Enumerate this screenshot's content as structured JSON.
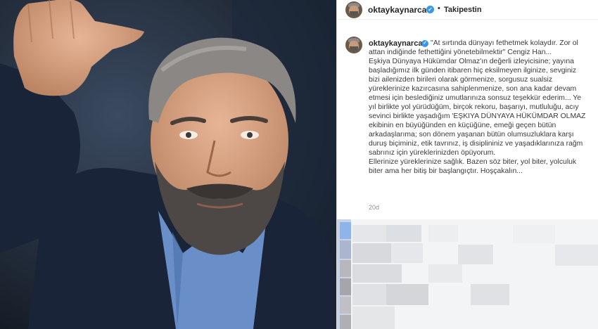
{
  "post": {
    "username": "oktaykaynarca",
    "follow_status": "Takipestin",
    "separator": "•",
    "verified_glyph": "✓",
    "caption_lines": [
      "\"At sırtında dünyayı fethetmek kolaydır. Zor ol",
      "attan indiğinde fethettiğini yönetebilmektir\" Cengiz Han...",
      "Eşkiya Dünyaya Hükümdar Olmaz'ın değerli izleyicisine; yayına",
      "başladığımız ilk günden itibaren hiç eksilmeyen ilginize, sevginiz",
      "bizi ailenizden birileri olarak görmenize, sorgusuz sualsiz",
      "yüreklerinize kazırcasına sahiplenmenize, son ana kadar devam",
      "etmesi için beslediğiniz umutlarınıza sonsuz teşekkür ederim... Ye",
      "yıl birlikte yol yürüdüğüm, birçok rekoru, başarıyı, mutluluğu, acıy",
      "sevinci birlikte yaşadığım 'EŞKIYA DÜNYAYA HÜKÜMDAR OLMAZ",
      "ekibinin en büyüğünden en küçüğüne, emeği geçen bütün",
      "arkadaşlarıma; son dönem yaşanan bütün olumsuzluklara karşı",
      "duruş biçiminiz, etik tavrınız, iş disiplininiz ve yaşadıklarınıza rağm",
      "sabrınız için yüreklerinizden öpüyorum.",
      "Ellerinize yüreklerinize sağlık. Bazen söz biter, yol biter, yolculuk",
      "biter ama her bitiş bir başlangıçtır. Hoşçakalın..."
    ],
    "time_ago": "20d"
  },
  "colors": {
    "verified": "#3897f0",
    "text": "#262626",
    "muted": "#8e8e8e"
  },
  "icons": {
    "verified": "verified-badge-icon"
  }
}
